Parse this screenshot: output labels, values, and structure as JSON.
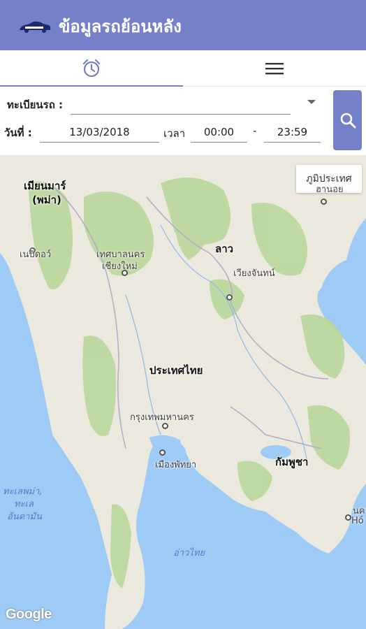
{
  "header": {
    "title": "ข้อมูลรถย้อนหลัง",
    "logo_icon": "car-logo-icon"
  },
  "tabs": [
    {
      "icon": "alarm-clock-icon",
      "active": true
    },
    {
      "icon": "hamburger-menu-icon",
      "active": false
    }
  ],
  "form": {
    "plate_label": "ทะเบียนรถ :",
    "plate_value": "",
    "date_label": "วันที่ :",
    "date_value": "13/03/2018",
    "time_label": "เวลา",
    "time_start": "00:00",
    "time_separator": "-",
    "time_end": "23:59",
    "search_icon": "search-icon"
  },
  "map": {
    "map_type_button": "ภูมิประเทศ",
    "attribution": "Google",
    "labels": {
      "myanmar": "เมียนมาร์",
      "myanmar_paren": "(พม่า)",
      "naypyidaw": "เนปิดอว์",
      "chiangmai_1": "เทศบาลนคร",
      "chiangmai_2": "เชียงใหม่",
      "laos": "ลาว",
      "vientiane": "เวียงจันทน์",
      "thailand": "ประเทศไทย",
      "bangkok": "กรุงเทพมหานคร",
      "pattaya": "เมืองพัทยา",
      "cambodia": "กัมพูชา",
      "andaman_1": "ทะเลพม่า,",
      "andaman_2": "ทะเล",
      "andaman_3": "อันดามัน",
      "gulf": "อ่าวไทย",
      "hanoi_partial": "ฮานอย",
      "hcm_partial_1": "นคร",
      "hcm_partial_2": "Hồ"
    },
    "colors": {
      "sea": "#9ecbf5",
      "land": "#ebe8de",
      "forest": "#b9d79a",
      "accent": "#7580c8"
    }
  }
}
